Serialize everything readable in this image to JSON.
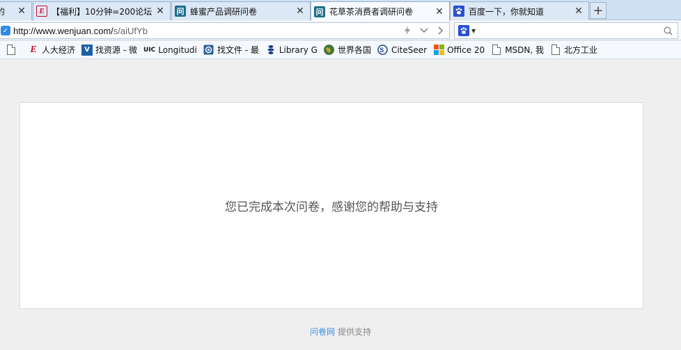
{
  "browser": {
    "tabs": [
      {
        "label": "的",
        "icon": "page-icon",
        "active": false
      },
      {
        "label": "【福利】10分钟=200论坛",
        "icon": "e-logo-icon",
        "active": false
      },
      {
        "label": "蜂蜜产品调研问卷",
        "icon": "wenjuan-icon",
        "active": false
      },
      {
        "label": "花草茶消费者调研问卷",
        "icon": "wenjuan-icon",
        "active": true
      },
      {
        "label": "百度一下，你就知道",
        "icon": "baidu-paw-icon",
        "active": false
      }
    ],
    "new_tab_symbol": "+",
    "close_symbol": "✕",
    "address": {
      "url_host": "http://www.wenjuan.com/",
      "url_path": "s/aiUfYb"
    },
    "search": {
      "placeholder": "",
      "engine_icon": "baidu-paw-icon"
    },
    "bookmarks": [
      {
        "label": "",
        "icon": "page-icon"
      },
      {
        "label": "人大经济",
        "icon": "e-logo-icon"
      },
      {
        "label": "找资源 - 微",
        "icon": "v-logo-icon"
      },
      {
        "label": "Longitudi",
        "icon": "uic-logo-icon",
        "icon_text": "UIC"
      },
      {
        "label": "找文件 - 最",
        "icon": "target-icon"
      },
      {
        "label": "Library G",
        "icon": "library-icon"
      },
      {
        "label": "世界各国",
        "icon": "globe-icon"
      },
      {
        "label": "CiteSeer",
        "icon": "citeseer-icon"
      },
      {
        "label": "Office 20",
        "icon": "windows-logo-icon"
      },
      {
        "label": "MSDN, 我",
        "icon": "page-icon"
      },
      {
        "label": "北方工业",
        "icon": "page-icon"
      }
    ]
  },
  "page": {
    "completion_message": "您已完成本次问卷，感谢您的帮助与支持",
    "footer_brand": "问卷网",
    "footer_text": "提供支持"
  },
  "colors": {
    "brand_link": "#3d8ee8",
    "tab_bar": "#cfe0f3"
  }
}
